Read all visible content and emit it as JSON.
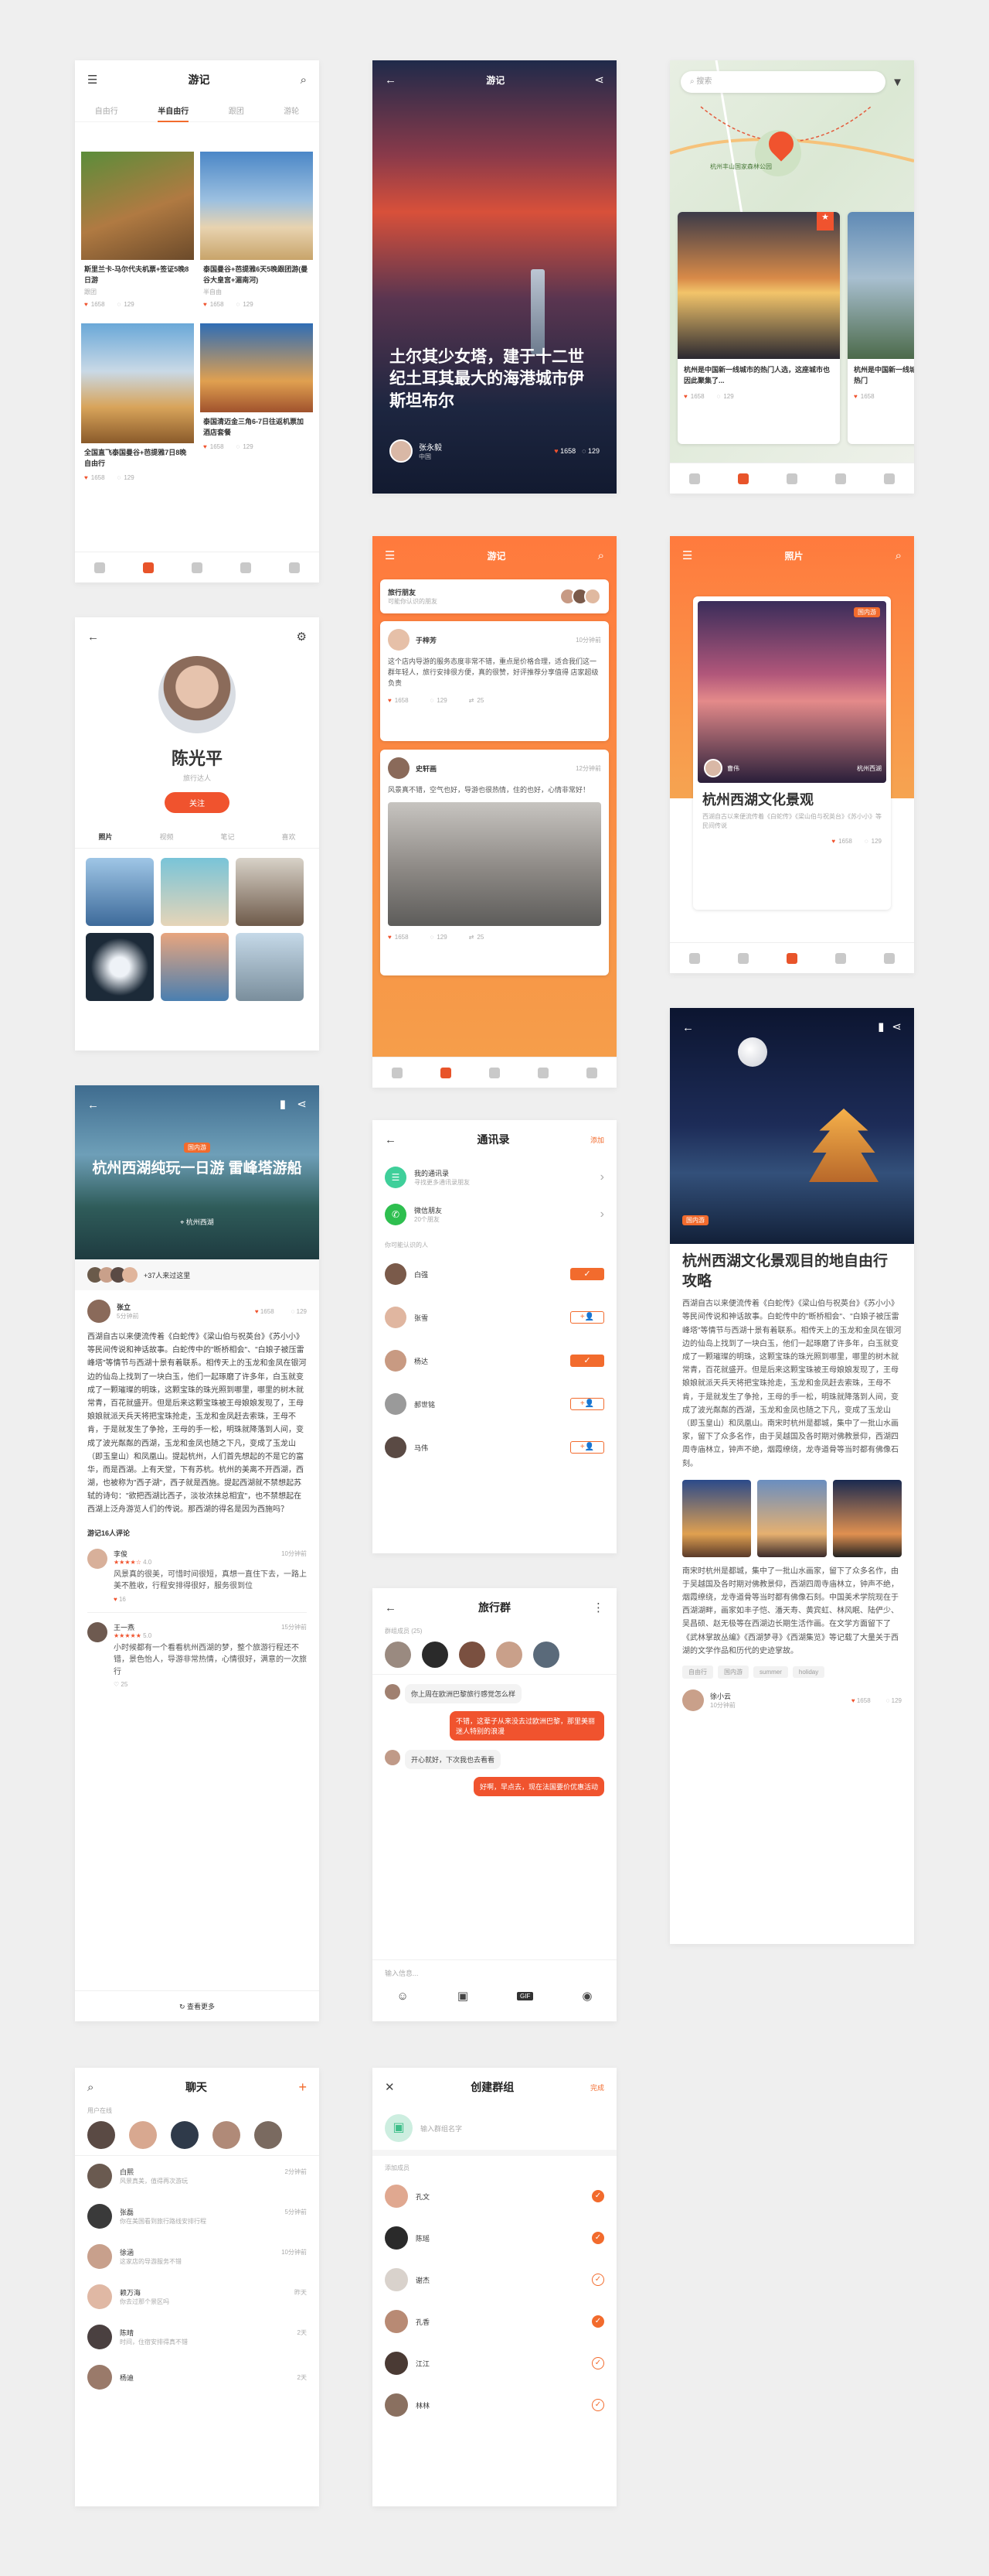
{
  "s1": {
    "title": "游记",
    "tabs": [
      "自由行",
      "半自由行",
      "跟团",
      "游轮"
    ],
    "cards": [
      {
        "t": "斯里兰卡-马尔代夫机票+签证5晚8日游",
        "tag": "跟团",
        "likes": "1658",
        "cm": "129"
      },
      {
        "t": "泰国曼谷+芭提雅6天5晚跟团游(曼谷大皇宫+湄南河)",
        "tag": "半自由",
        "likes": "1658",
        "cm": "129"
      },
      {
        "t": "全国直飞泰国曼谷+芭提雅7日8晚自由行",
        "tag": "",
        "likes": "1658",
        "cm": "129"
      },
      {
        "t": "泰国清迈金三角6-7日往返机票加酒店套餐",
        "tag": "",
        "likes": "1658",
        "cm": "129"
      }
    ]
  },
  "s2": {
    "title": "游记",
    "headline": "土尔其少女塔，建于十二世纪土耳其最大的海港城市伊斯坦布尔",
    "user": "张永毅",
    "loc": "中国",
    "likes": "1658",
    "cm": "129"
  },
  "s3": {
    "search": "搜索",
    "map_label": "杭州丰山国家森林公园",
    "cards": [
      {
        "t": "杭州是中国新一线城市的热门人选，这座城市也因此聚集了...",
        "likes": "1658",
        "cm": "129"
      },
      {
        "t": "杭州是中国新一线城市的热门",
        "likes": "1658",
        "cm": "129"
      }
    ]
  },
  "s4": {
    "name": "陈光平",
    "role": "旅行达人",
    "follow": "关注",
    "tabs": [
      "照片",
      "视频",
      "笔记",
      "喜欢"
    ]
  },
  "s5": {
    "title": "游记",
    "friend_t": "旅行朋友",
    "friend_s": "可能你认识的朋友",
    "posts": [
      {
        "name": "于梓芳",
        "time": "10分钟前",
        "text": "这个店内导游的服务态度非常不错，重点是价格合理，适合我们这一群年轻人，旅行安排很方便，真的很赞，好评推荐分享值得 店家超级负责",
        "likes": "1658",
        "cm": "129",
        "sh": "25"
      },
      {
        "name": "史轩画",
        "time": "12分钟前",
        "text": "风景真不错，空气也好，导游也很热情，住的也好，心情非常好！",
        "likes": "1658",
        "cm": "129",
        "sh": "25"
      }
    ]
  },
  "s6": {
    "title": "照片",
    "tag": "国内游",
    "user": "曹伟",
    "loc": "杭州西湖",
    "headline": "杭州西湖文化景观",
    "desc": "西湖自古以来便流传着《白蛇传》《梁山伯与祝英台》《苏小小》等民间传说",
    "likes": "1658",
    "cm": "129"
  },
  "s7": {
    "tag": "国内游",
    "title": "杭州西湖纯玩一日游 雷峰塔游船",
    "loc": "杭州西湖",
    "visitors": "+37人来过这里",
    "author": "张立",
    "atime": "5分钟前",
    "likes": "1658",
    "cm": "129",
    "body": "西湖自古以来便流传着《白蛇传》《梁山伯与祝英台》《苏小小》等民间传说和神话故事。白蛇传中的\"断桥相会\"、\"白娘子被压雷峰塔\"等情节与西湖十景有着联系。相传天上的玉龙和金凤在银河边的仙岛上找到了一块白玉，他们一起琢磨了许多年，白玉就变成了一颗璀璨的明珠，这颗宝珠的珠光照到哪里，哪里的树木就常青，百花就盛开。但是后来这颗宝珠被王母娘娘发现了，王母娘娘就派天兵天将把宝珠抢走，玉龙和金凤赶去索珠，王母不肯，于是就发生了争抢，王母的手一松，明珠就降落到人间，变成了波光粼粼的西湖，玉龙和金凤也随之下凡，变成了玉龙山（即玉皇山）和凤凰山。提起杭州，人们首先想起的不是它的富华，而是西湖。上有天堂，下有苏杭。杭州的美离不开西湖，西湖，也被称为\"西子湖\"，西子就是西施。提起西湖就不禁想起苏轼的诗句：\"欲把西湖比西子，淡妆浓抹总相宜\"，也不禁想起在西湖上泛舟游览人们的传说。那西湖的得名是因为西施吗？",
    "ctitle": "游记16人评论",
    "comments": [
      {
        "n": "李俊",
        "t": "10分钟前",
        "r": "4.0",
        "x": "风景真的很美，可惜时间很短，真想一直住下去，一路上美不胜收，行程安排得很好，服务很到位",
        "l": "16"
      },
      {
        "n": "王一燕",
        "t": "15分钟前",
        "r": "5.0",
        "x": "小时候都有一个看看杭州西湖的梦，整个旅游行程还不错，景色怡人，导游非常热情，心情很好，满意的一次旅行",
        "l": "25"
      }
    ],
    "more": "查看更多"
  },
  "s8": {
    "title": "通讯录",
    "add": "添加",
    "items": [
      {
        "t": "我的通讯录",
        "s": "寻找更多通讯录朋友"
      },
      {
        "t": "微信朋友",
        "s": "20个朋友"
      }
    ],
    "sec": "你可能认识的人",
    "people": [
      "白强",
      "张雪",
      "杨达",
      "郝世铭",
      "马伟"
    ]
  },
  "s9": {
    "tag": "国内游",
    "title": "杭州西湖文化景观目的地自由行攻略",
    "p1": "西湖自古以来便流传着《白蛇传》《梁山伯与祝英台》《苏小小》等民间传说和神话故事。白蛇传中的\"断桥相会\"、\"白娘子被压雷峰塔\"等情节与西湖十景有着联系。相传天上的玉龙和金凤在银河边的仙岛上找到了一块白玉，他们一起琢磨了许多年，白玉就变成了一颗璀璨的明珠，这颗宝珠的珠光照到哪里，哪里的树木就常青，百花就盛开。但是后来这颗宝珠被王母娘娘发现了，王母娘娘就派天兵天将把宝珠抢走，玉龙和金凤赶去索珠，王母不肯，于是就发生了争抢，王母的手一松，明珠就降落到人间，变成了波光粼粼的西湖，玉龙和金凤也随之下凡，变成了玉龙山（即玉皇山）和凤凰山。南宋时杭州是都城，集中了一批山水画家，留下了众多名作，由于吴越国及各时期对佛教景仰，西湖四周寺庙林立，钟声不绝，烟霞缭绕，龙寺道骨等当时都有佛像石刻。",
    "p2": "南宋时杭州是都城，集中了一批山水画家，留下了众多名作，由于吴越国及各时期对佛教景仰，西湖四周寺庙林立，钟声不绝，烟霞缭绕，龙寺道骨等当时都有佛像石刻。中国美术学院现在于西湖湖畔，画家如丰子恺、潘天寿、黄宾虹、林风眠、陆俨少、吴昌硕、赵无极等在西湖边长期生活作画。在文学方面留下了《武林掌故丛编》《西湖梦寻》《西湖集览》等记载了大量关于西湖的文学作品和历代的史迹掌故。",
    "tags": [
      "自由行",
      "国内游",
      "summer",
      "holiday"
    ],
    "user": "徐小云",
    "utime": "10分钟前",
    "likes": "1658",
    "cm": "129"
  },
  "s10": {
    "title": "旅行群",
    "sec": "群组成员 (25)",
    "msgs": [
      {
        "s": "l",
        "t": "你上周在欧洲巴黎旅行感觉怎么样"
      },
      {
        "s": "r",
        "t": "不错，这辈子从来没去过欧洲巴黎，那里美丽迷人特别的浪漫"
      },
      {
        "s": "l",
        "t": "开心就好，下次我也去看看"
      },
      {
        "s": "r",
        "t": "好啊，早点去，现在法国要价优惠活动"
      }
    ],
    "input": "输入信息...",
    "gif": "GIF"
  },
  "s11": {
    "title": "聊天",
    "sec": "用户在线",
    "chats": [
      {
        "n": "白熙",
        "m": "风景真美，值得再次游玩",
        "t": "2分钟前"
      },
      {
        "n": "张磊",
        "m": "你在美国看到旅行路线安排行程",
        "t": "5分钟前"
      },
      {
        "n": "徐涵",
        "m": "这家店的导游服务不错",
        "t": "10分钟前"
      },
      {
        "n": "赖万海",
        "m": "你去过那个景区吗",
        "t": "昨天"
      },
      {
        "n": "陈晴",
        "m": "时间，住宿安排得真不错",
        "t": "2天"
      },
      {
        "n": "杨迪",
        "m": "",
        "t": "2天"
      }
    ]
  },
  "s12": {
    "title": "创建群组",
    "done": "完成",
    "placeholder": "输入群组名字",
    "sec": "添加成员",
    "people": [
      "孔文",
      "陈瑶",
      "谢杰",
      "孔香",
      "江江",
      "林林"
    ]
  },
  "colors": {
    "accent": "#f26b2d",
    "accent2": "#f0532e",
    "bg": "#efefef"
  }
}
